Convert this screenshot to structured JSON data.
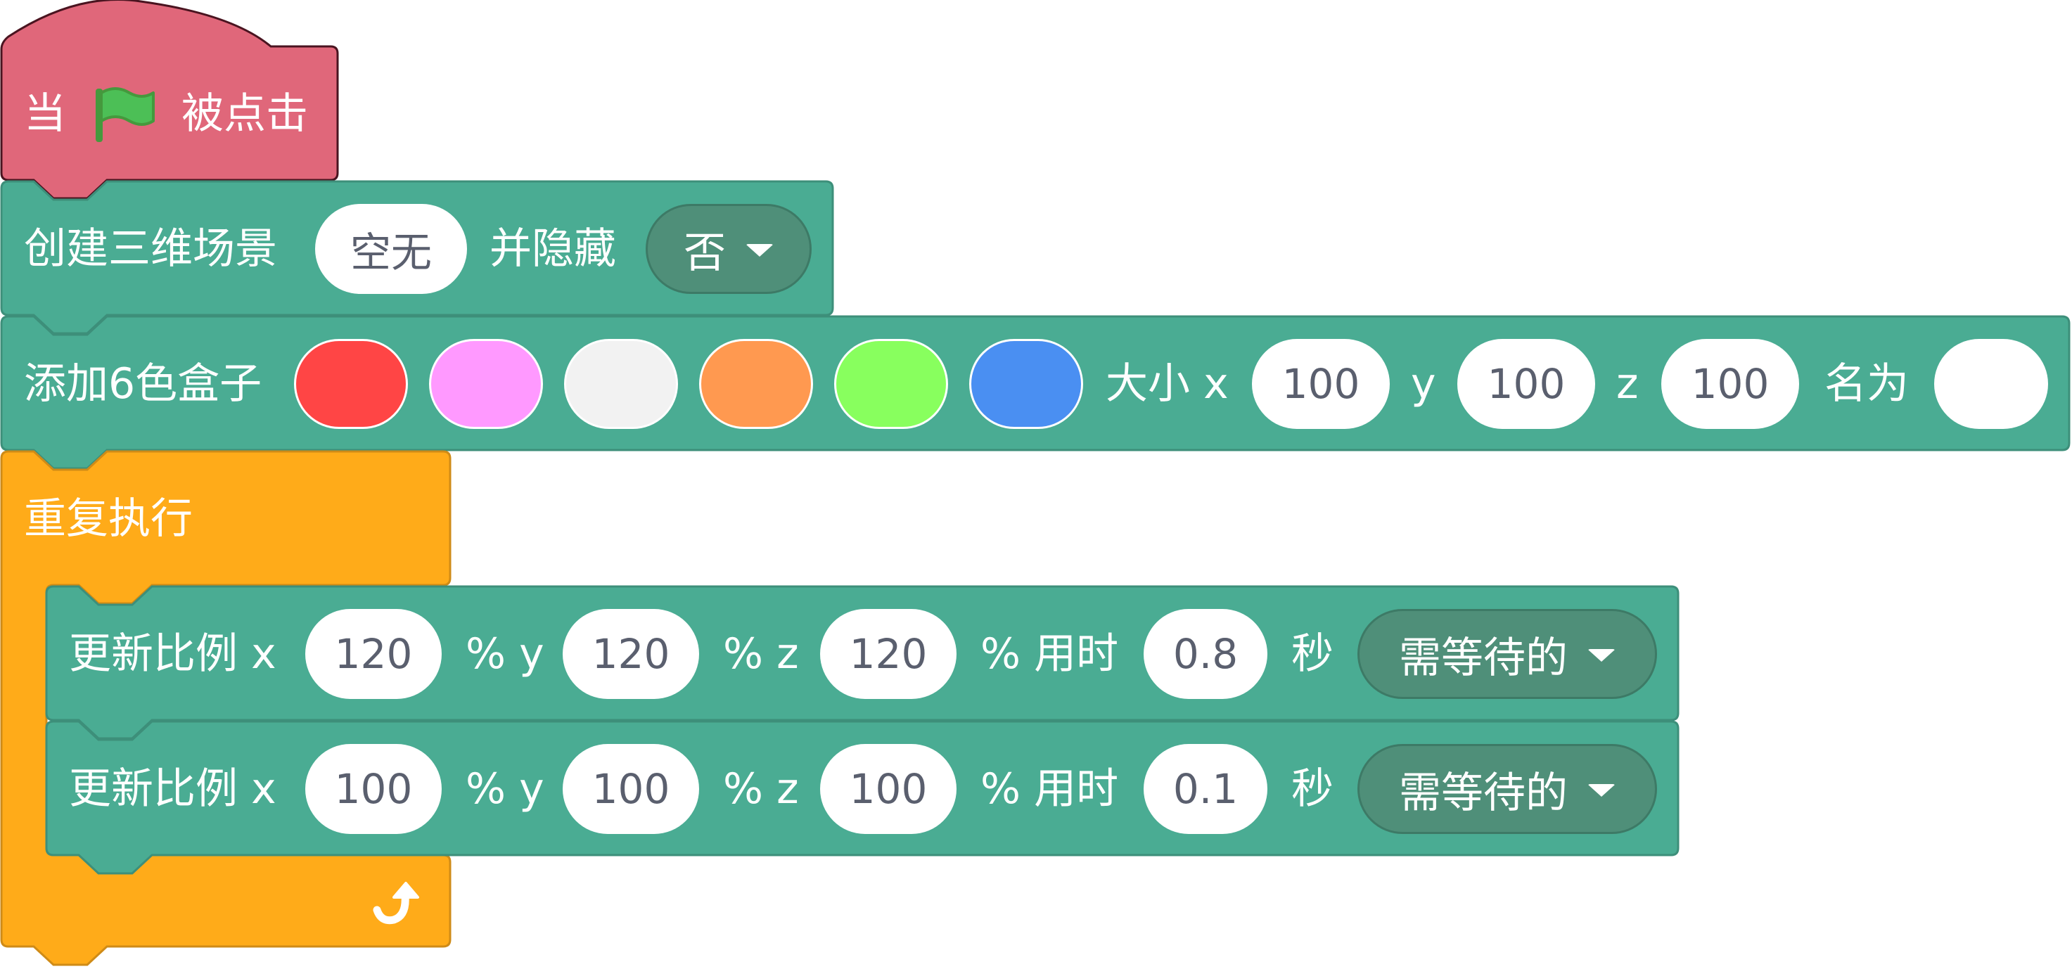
{
  "colors": {
    "event_block": "#e0677a",
    "extension_block": "#4aac93",
    "control_block": "#ffab19",
    "dropdown_bg": "#4f8f79",
    "flag": "#4cbf56"
  },
  "hat_block": {
    "prefix": "当",
    "icon": "green-flag-icon",
    "suffix": "被点击"
  },
  "create_scene_block": {
    "label": "创建三维场景",
    "scene_value": "空无",
    "hide_label": "并隐藏",
    "hide_option": "否"
  },
  "add_box_block": {
    "label": "添加6色盒子",
    "face_colors": [
      "#ff4545",
      "#ff99ff",
      "#f2f2f2",
      "#ff9950",
      "#88ff5e",
      "#4a8ff2"
    ],
    "size_label": "大小 x",
    "x_value": "100",
    "y_label": "y",
    "y_value": "100",
    "z_label": "z",
    "z_value": "100",
    "name_label": "名为",
    "name_value": ""
  },
  "forever_block": {
    "label": "重复执行",
    "loop_icon": "loop-arrow-icon"
  },
  "scale_blocks": [
    {
      "label": "更新比例 x",
      "x_value": "120",
      "pct_y_label": "% y",
      "y_value": "120",
      "pct_z_label": "% z",
      "z_value": "120",
      "pct_time_label": "% 用时",
      "time_value": "0.8",
      "sec_label": "秒",
      "wait_option": "需等待的"
    },
    {
      "label": "更新比例 x",
      "x_value": "100",
      "pct_y_label": "% y",
      "y_value": "100",
      "pct_z_label": "% z",
      "z_value": "100",
      "pct_time_label": "% 用时",
      "time_value": "0.1",
      "sec_label": "秒",
      "wait_option": "需等待的"
    }
  ]
}
